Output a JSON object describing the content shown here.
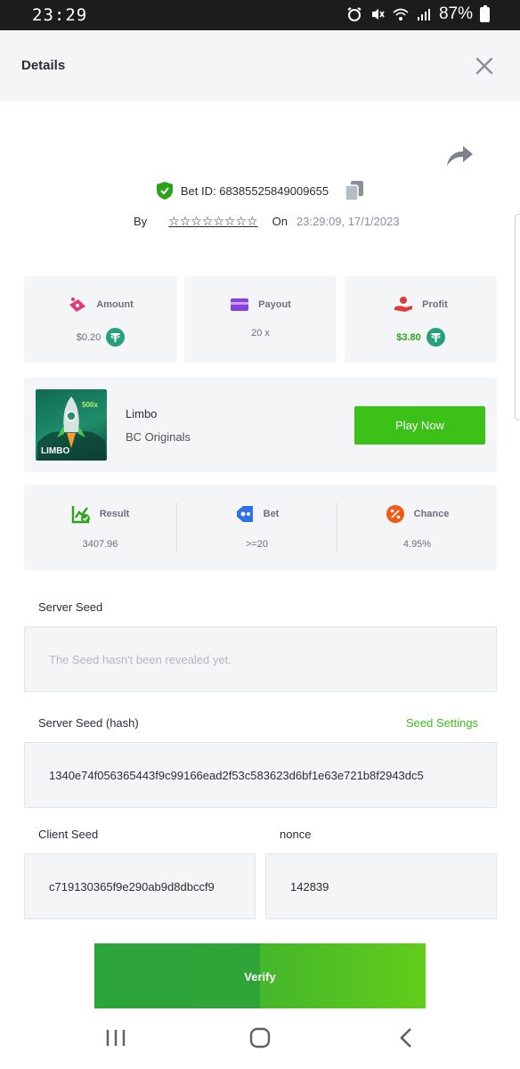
{
  "status_bar": {
    "time": "23:29",
    "battery": "87%"
  },
  "header": {
    "title": "Details"
  },
  "bet": {
    "id_label": "Bet ID: 68385525849009655",
    "by_label": "By",
    "user": "☆☆☆☆☆☆☆☆",
    "on_label": "On",
    "datetime": "23:29:09, 17/1/2023"
  },
  "stats": [
    {
      "label": "Amount",
      "value": "$0.20",
      "icon": "money-icon",
      "coin": "tether-icon"
    },
    {
      "label": "Payout",
      "value": "20 x",
      "icon": "card-icon"
    },
    {
      "label": "Profit",
      "value": "$3.80",
      "icon": "profit-hand-icon",
      "coin": "tether-icon",
      "value_color": "#2ea21d"
    }
  ],
  "game": {
    "name": "Limbo",
    "provider": "BC Originals",
    "play_label": "Play Now",
    "thumb_text": "LIMBO",
    "thumb_badge": "500x"
  },
  "result": [
    {
      "label": "Result",
      "value": "3407.96",
      "icon": "result-chart-icon"
    },
    {
      "label": "Bet",
      "value": ">=20",
      "icon": "tag-icon"
    },
    {
      "label": "Chance",
      "value": "4.95%",
      "icon": "percent-icon"
    }
  ],
  "seeds": {
    "server_seed_label": "Server Seed",
    "server_seed_value": "The Seed hasn't been revealed yet.",
    "server_hash_label": "Server Seed (hash)",
    "seed_settings_label": "Seed Settings",
    "server_hash_value": "1340e74f056365443f9c99166ead2f53c583623d6bf1e63e721b8f2943dc5",
    "client_seed_label": "Client Seed",
    "client_seed_value": "c719130365f9e290ab9d8dbccf9",
    "nonce_label": "nonce",
    "nonce_value": "142839"
  },
  "verify_label": "Verify",
  "colors": {
    "accent": "#3bc117",
    "card_bg": "#f4f5f7",
    "tether": "#26a17b"
  }
}
